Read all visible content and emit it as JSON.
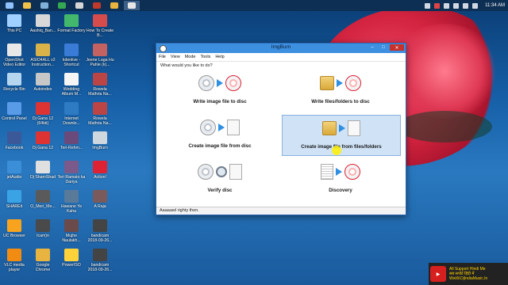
{
  "desktop": {
    "icons": [
      {
        "label": "This PC",
        "color": "#9fd0ff"
      },
      {
        "label": "Aashiq_Ban...",
        "color": "#d8d8d8"
      },
      {
        "label": "Format Factory",
        "color": "#43b86d"
      },
      {
        "label": "How To Create B...",
        "color": "#d64c4c"
      },
      {
        "label": "OpenShot Video Editor",
        "color": "#e8e8e8"
      },
      {
        "label": "ASIO4ALL v2 Instruction...",
        "color": "#d9b34a"
      },
      {
        "label": "kdenlive - Shortcut",
        "color": "#3a7bd5"
      },
      {
        "label": "Jeene Laga Hu Pahle (k)...",
        "color": "#c46161"
      },
      {
        "label": "Recycle Bin",
        "color": "#b6d6ef"
      },
      {
        "label": "Autoindex",
        "color": "#c7c7c7"
      },
      {
        "label": "Wedding Album M...",
        "color": "#f5f5f5"
      },
      {
        "label": "Rowela Mathria Na...",
        "color": "#b44"
      },
      {
        "label": "Control Panel",
        "color": "#5a9be8"
      },
      {
        "label": "Dj Gana 12 (64bit)",
        "color": "#d33"
      },
      {
        "label": "Internet Downlo...",
        "color": "#2e7bc4"
      },
      {
        "label": "Rowela Mathria Na...",
        "color": "#b44"
      },
      {
        "label": "Facebook",
        "color": "#3b5998"
      },
      {
        "label": "Dj Gana 12",
        "color": "#d33"
      },
      {
        "label": "Teri-Rehm...",
        "color": "#6a4a7a"
      },
      {
        "label": "ImgBurn",
        "color": "#cfd7df"
      },
      {
        "label": "jetAudio",
        "color": "#3b8ed8"
      },
      {
        "label": "Dj ShamShad",
        "color": "#e0e0e0"
      },
      {
        "label": "Teri Ramato ka Dariya",
        "color": "#7a5a8a"
      },
      {
        "label": "Action!",
        "color": "#d23"
      },
      {
        "label": "SHAREit",
        "color": "#3aa3e6"
      },
      {
        "label": "O_Meri_Me...",
        "color": "#5a5a5a"
      },
      {
        "label": "Hawane Ye Kaha",
        "color": "#5a7a9a"
      },
      {
        "label": "A Raja",
        "color": "#7a5a5a"
      },
      {
        "label": "UC Browser",
        "color": "#f7a31d"
      },
      {
        "label": "Icam)n",
        "color": "#4a4a4a"
      },
      {
        "label": "Mujhe Naulakh...",
        "color": "#6a4a4a"
      },
      {
        "label": "bandicam 2018-09-26...",
        "color": "#444"
      },
      {
        "label": "VLC media player",
        "color": "#f28b11"
      },
      {
        "label": "Google Chrome",
        "color": "#e8b33e"
      },
      {
        "label": "PowerISO",
        "color": "#ffd23a"
      },
      {
        "label": "bandicam 2018-09-26...",
        "color": "#444"
      }
    ]
  },
  "taskbar": {
    "clock": "11:34 AM"
  },
  "window": {
    "title": "ImgBurn",
    "menu": [
      "File",
      "View",
      "Mode",
      "Tools",
      "Help"
    ],
    "prompt": "What would you like to do?",
    "tiles": [
      {
        "label": "Write image file to disc"
      },
      {
        "label": "Write files/folders to disc"
      },
      {
        "label": "Create image file from disc"
      },
      {
        "label": "Create image file from files/folders"
      },
      {
        "label": "Verify disc"
      },
      {
        "label": "Discovery"
      }
    ],
    "status": "Aaaaawl righty then."
  },
  "watermark": {
    "line1": "All Support Hindi Me",
    "line2": "सब सपोर्ट हिंदी में",
    "line3": "WwW.DjIndiaMusic.In"
  }
}
